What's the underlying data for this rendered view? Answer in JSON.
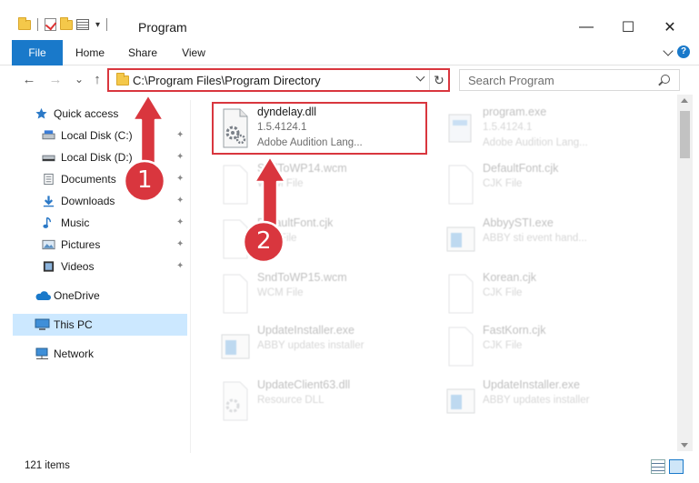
{
  "window": {
    "title": "Program",
    "minimize_glyph": "—",
    "maximize_glyph": "☐",
    "close_glyph": "✕"
  },
  "ribbon": {
    "tabs": [
      "File",
      "Home",
      "Share",
      "View"
    ],
    "help_glyph": "?"
  },
  "nav": {
    "back_glyph": "←",
    "forward_glyph": "→",
    "recent_glyph": "⌄",
    "up_glyph": "↑",
    "address": "C:\\Program Files\\Program Directory",
    "refresh_glyph": "↻",
    "search_placeholder": "Search Program"
  },
  "sidebar": {
    "items": [
      {
        "label": "Quick access",
        "icon": "star-icon"
      },
      {
        "label": "Local Disk (C:)",
        "icon": "drive-icon",
        "pinned": true
      },
      {
        "label": "Local Disk (D:)",
        "icon": "drive-icon",
        "pinned": true
      },
      {
        "label": "Documents",
        "icon": "documents-icon",
        "pinned": true
      },
      {
        "label": "Downloads",
        "icon": "downloads-icon",
        "pinned": true
      },
      {
        "label": "Music",
        "icon": "music-icon",
        "pinned": true
      },
      {
        "label": "Pictures",
        "icon": "pictures-icon",
        "pinned": true
      },
      {
        "label": "Videos",
        "icon": "videos-icon",
        "pinned": true
      },
      {
        "label": "OneDrive",
        "icon": "cloud-icon"
      },
      {
        "label": "This PC",
        "icon": "computer-icon",
        "selected": true
      },
      {
        "label": "Network",
        "icon": "network-icon"
      }
    ],
    "pin_glyph": "📌"
  },
  "files": [
    {
      "name": "dyndelay.dll",
      "line2": "1.5.4124.1",
      "line3": "Adobe Audition Lang...",
      "icon": "dll-gear-icon",
      "highlighted": true
    },
    {
      "name": "program.exe",
      "line2": "1.5.4124.1",
      "line3": "Adobe Audition Lang...",
      "icon": "exe-icon"
    },
    {
      "name": "SndToWP14.wcm",
      "line2": "WCM File",
      "line3": "",
      "icon": "blank-file-icon"
    },
    {
      "name": "DefaultFont.cjk",
      "line2": "CJK File",
      "line3": "",
      "icon": "blank-file-icon"
    },
    {
      "name": "DefaultFont.cjk",
      "line2": "CJK File",
      "line3": "",
      "icon": "blank-file-icon"
    },
    {
      "name": "AbbyySTI.exe",
      "line2": "ABBY sti event hand...",
      "line3": "",
      "icon": "app-window-icon"
    },
    {
      "name": "SndToWP15.wcm",
      "line2": "WCM File",
      "line3": "",
      "icon": "blank-file-icon"
    },
    {
      "name": "Korean.cjk",
      "line2": "CJK File",
      "line3": "",
      "icon": "blank-file-icon"
    },
    {
      "name": "UpdateInstaller.exe",
      "line2": "ABBY updates installer",
      "line3": "",
      "icon": "app-window-icon"
    },
    {
      "name": "FastKorn.cjk",
      "line2": "CJK File",
      "line3": "",
      "icon": "blank-file-icon"
    },
    {
      "name": "UpdateClient63.dll",
      "line2": "Resource DLL",
      "line3": "",
      "icon": "dll-gear-icon"
    },
    {
      "name": "UpdateInstaller.exe",
      "line2": "ABBY updates installer",
      "line3": "",
      "icon": "app-window-icon"
    }
  ],
  "status": {
    "item_count": "121 items"
  },
  "annotations": {
    "step1": "1",
    "step2": "2",
    "arrow_color": "#d9363e"
  }
}
